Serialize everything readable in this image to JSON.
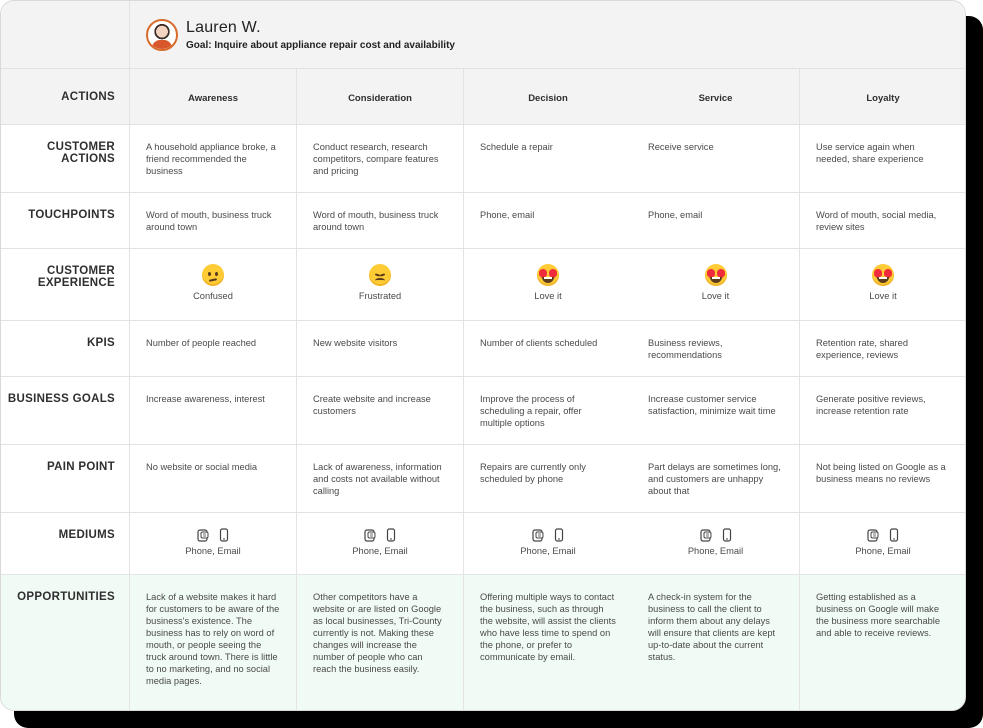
{
  "persona": {
    "name": "Lauren W.",
    "goal": "Goal: Inquire about appliance repair cost and availability"
  },
  "stages": [
    "Awareness",
    "Consideration",
    "Decision",
    "Service",
    "Loyalty"
  ],
  "rows": {
    "actions": "ACTIONS",
    "customer_actions": {
      "label": "CUSTOMER ACTIONS",
      "cells": [
        "A household appliance broke, a friend recommended the business",
        "Conduct research, research competitors, compare features and pricing",
        "Schedule a repair",
        "Receive service",
        "Use service again when needed, share experience"
      ]
    },
    "touchpoints": {
      "label": "TOUCHPOINTS",
      "cells": [
        "Word of mouth, business truck around town",
        "Word of mouth, business truck around town",
        "Phone, email",
        "Phone, email",
        "Word of mouth, social media, review sites"
      ]
    },
    "customer_experience": {
      "label": "CUSTOMER EXPERIENCE",
      "cells": [
        {
          "emoji": "confused-face-icon",
          "label": "Confused"
        },
        {
          "emoji": "frustrated-face-icon",
          "label": "Frustrated"
        },
        {
          "emoji": "heart-eyes-face-icon",
          "label": "Love it"
        },
        {
          "emoji": "heart-eyes-face-icon",
          "label": "Love it"
        },
        {
          "emoji": "heart-eyes-face-icon",
          "label": "Love it"
        }
      ]
    },
    "kpis": {
      "label": "KPIS",
      "cells": [
        "Number of people reached",
        "New website visitors",
        "Number of clients scheduled",
        "Business reviews, recommendations",
        "Retention rate, shared experience, reviews"
      ]
    },
    "business_goals": {
      "label": "BUSINESS GOALS",
      "cells": [
        "Increase awareness, interest",
        "Create website  and increase customers",
        "Improve the process of scheduling a repair, offer multiple options",
        "Increase customer service satisfaction, minimize wait time",
        "Generate positive reviews, increase retention rate"
      ]
    },
    "pain_point": {
      "label": "PAIN POINT",
      "cells": [
        "No website or social media",
        "Lack of awareness, information and costs not available without calling",
        "Repairs are currently only scheduled by phone",
        "Part delays are sometimes long, and customers are unhappy about that",
        "Not being listed on Google as a business means no reviews"
      ]
    },
    "mediums": {
      "label": "MEDIUMS",
      "cells": [
        "Phone, Email",
        "Phone, Email",
        "Phone, Email",
        "Phone, Email",
        "Phone, Email"
      ]
    },
    "opportunities": {
      "label": "OPPORTUNITIES",
      "cells": [
        "Lack of a website makes it hard for customers to be aware of the business's existence. The business has to rely on word of mouth, or people seeing the truck around town. There is little to no marketing, and no social media pages.",
        "Other competitors have a website or are listed on Google as local businesses, Tri-County currently is not. Making these changes will increase the number of people who can reach the business easily.",
        "Offering multiple ways to contact the business, such as through the website, will assist the clients who have less time to spend on the phone, or prefer to communicate by email.",
        "A check-in system for the business to call the client to inform them about any delays will ensure that clients are kept up-to-date about the current status.",
        "Getting established as a business on Google will make the business more searchable and able to receive reviews."
      ]
    }
  },
  "colors": {
    "header_bg": "#f3f3f3",
    "opportunities_bg": "#f1fbf5",
    "emoji_yellow": "#ffcc35",
    "heart_red": "#ef2d3d"
  }
}
